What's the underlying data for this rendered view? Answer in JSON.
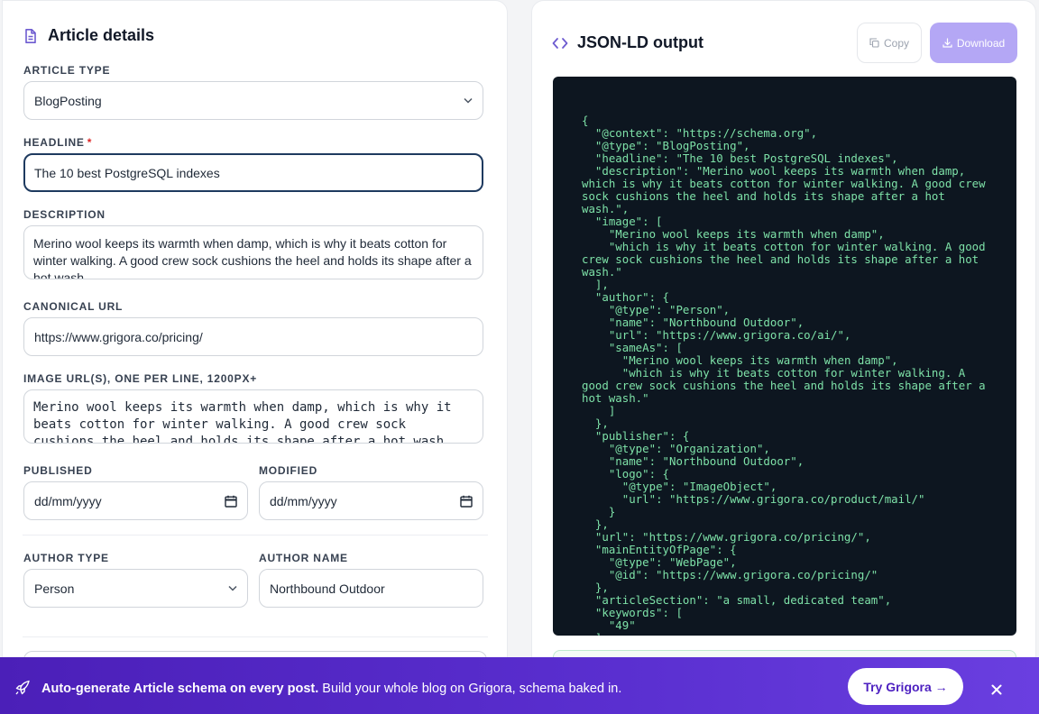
{
  "form": {
    "title": "Article details",
    "article_type": {
      "label": "ARTICLE TYPE",
      "value": "BlogPosting"
    },
    "headline": {
      "label": "HEADLINE",
      "required_mark": "*",
      "value": "The 10 best PostgreSQL indexes"
    },
    "description": {
      "label": "DESCRIPTION",
      "value": "Merino wool keeps its warmth when damp, which is why it beats cotton for winter walking. A good crew sock cushions the heel and holds its shape after a hot wash."
    },
    "canonical_url": {
      "label": "CANONICAL URL",
      "value": "https://www.grigora.co/pricing/"
    },
    "image_urls": {
      "label": "IMAGE URL(S), ONE PER LINE, 1200PX+",
      "value": "Merino wool keeps its warmth when damp, which is why it beats cotton for winter walking. A good crew sock cushions the heel and holds its shape after a hot wash."
    },
    "published": {
      "label": "PUBLISHED",
      "placeholder": "dd/mm/yyyy"
    },
    "modified": {
      "label": "MODIFIED",
      "placeholder": "dd/mm/yyyy"
    },
    "author_type": {
      "label": "AUTHOR TYPE",
      "value": "Person"
    },
    "author_name": {
      "label": "AUTHOR NAME",
      "value": "Northbound Outdoor"
    }
  },
  "output": {
    "title": "JSON-LD output",
    "copy_label": "Copy",
    "download_label": "Download",
    "json": "{\n  \"@context\": \"https://schema.org\",\n  \"@type\": \"BlogPosting\",\n  \"headline\": \"The 10 best PostgreSQL indexes\",\n  \"description\": \"Merino wool keeps its warmth when damp, which is why it beats cotton for winter walking. A good crew sock cushions the heel and holds its shape after a hot wash.\",\n  \"image\": [\n    \"Merino wool keeps its warmth when damp\",\n    \"which is why it beats cotton for winter walking. A good crew sock cushions the heel and holds its shape after a hot wash.\"\n  ],\n  \"author\": {\n    \"@type\": \"Person\",\n    \"name\": \"Northbound Outdoor\",\n    \"url\": \"https://www.grigora.co/ai/\",\n    \"sameAs\": [\n      \"Merino wool keeps its warmth when damp\",\n      \"which is why it beats cotton for winter walking. A good crew sock cushions the heel and holds its shape after a hot wash.\"\n    ]\n  },\n  \"publisher\": {\n    \"@type\": \"Organization\",\n    \"name\": \"Northbound Outdoor\",\n    \"logo\": {\n      \"@type\": \"ImageObject\",\n      \"url\": \"https://www.grigora.co/product/mail/\"\n    }\n  },\n  \"url\": \"https://www.grigora.co/pricing/\",\n  \"mainEntityOfPage\": {\n    \"@type\": \"WebPage\",\n    \"@id\": \"https://www.grigora.co/pricing/\"\n  },\n  \"articleSection\": \"a small, dedicated team\",\n  \"keywords\": [\n    \"49\"\n  ],"
  },
  "banner": {
    "bold_text": "Auto-generate Article schema on every post.",
    "text": " Build your whole blog on Grigora, schema baked in.",
    "cta_label": "Try Grigora →"
  },
  "colors": {
    "accent": "#5b2fd4",
    "code_bg": "#0d1620",
    "code_text": "#7ee2a8",
    "focus_border": "#1e3a5f"
  },
  "icons": [
    "document-icon",
    "code-brackets-icon",
    "copy-icon",
    "download-icon",
    "chevron-down-icon",
    "calendar-icon",
    "rocket-icon",
    "close-icon"
  ]
}
